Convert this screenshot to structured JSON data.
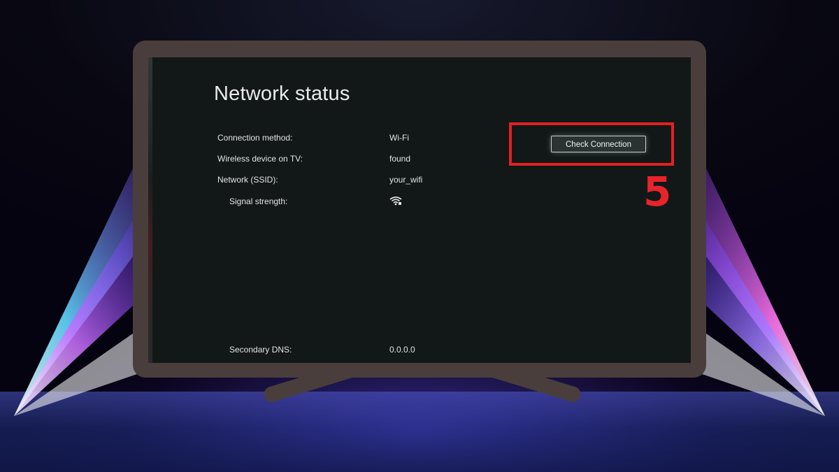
{
  "screen": {
    "title": "Network status",
    "rows": [
      {
        "label": "Connection method:",
        "value": "Wi-Fi"
      },
      {
        "label": "Wireless device on TV:",
        "value": "found"
      },
      {
        "label": "Network (SSID):",
        "value": "your_wifi"
      },
      {
        "label": "Signal strength:",
        "value": ""
      },
      {
        "label": "Secondary DNS:",
        "value": "0.0.0.0"
      }
    ],
    "signal_icon": "wifi-signal-icon",
    "check_button_label": "Check Connection"
  },
  "annotation": {
    "step_number": "5",
    "highlight_color": "#e32024"
  },
  "colors": {
    "tv_frame": "#4a3e3c",
    "screen_bg": "#121817",
    "beam_left": "#4fd8ff",
    "beam_right": "#ff5cf0"
  }
}
